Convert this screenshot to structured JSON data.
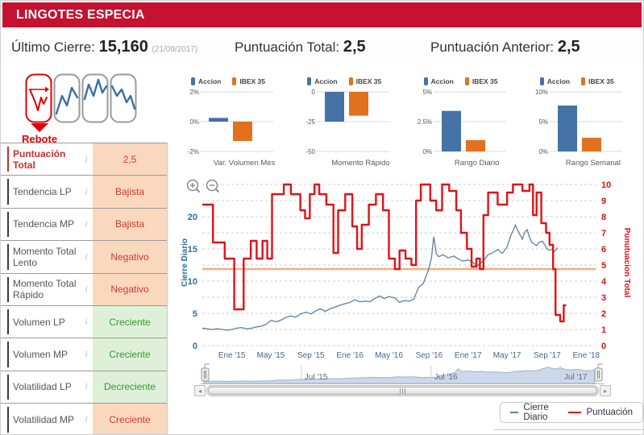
{
  "header": {
    "title": "LINGOTES ESPECIA"
  },
  "summary": {
    "ultimo_cierre": {
      "label": "Último Cierre:",
      "value": "15,160",
      "date": "(21/09/2017)"
    },
    "puntuacion_total": {
      "label": "Puntuación Total:",
      "value": "2,5"
    },
    "puntuacion_anterior": {
      "label": "Puntuación Anterior:",
      "value": "2,5"
    }
  },
  "patterns": {
    "active_label": "Rebote"
  },
  "indicators": {
    "rows": [
      {
        "label": "Puntuación Total",
        "value": "2,5",
        "tone": "neg",
        "highlight": true
      },
      {
        "label": "Tendencia LP",
        "value": "Bajista",
        "tone": "neg"
      },
      {
        "label": "Tendencia MP",
        "value": "Bajista",
        "tone": "neg"
      },
      {
        "label": "Momento Total Lento",
        "value": "Negativo",
        "tone": "neg"
      },
      {
        "label": "Momento Total Rápido",
        "value": "Negativo",
        "tone": "neg"
      },
      {
        "label": "Volumen LP",
        "value": "Creciente",
        "tone": "pos"
      },
      {
        "label": "Volumen MP",
        "value": "Creciente",
        "tone": "pos"
      },
      {
        "label": "Volatilidad LP",
        "value": "Decreciente",
        "tone": "pos"
      },
      {
        "label": "Volatilidad MP",
        "value": "Creciente",
        "tone": "neg"
      }
    ],
    "info_icon": "i"
  },
  "mini_legend": {
    "accion": "Accion",
    "ibex": "IBEX 35"
  },
  "colors": {
    "header_red": "#c51230",
    "accion_blue": "#4572a7",
    "ibex_orange": "#e2711d",
    "line_blue": "#5e7f9e",
    "line_red": "#e01217",
    "plotline_orange": "#f2b07a",
    "neg_bg": "#fad8be",
    "neg_text": "#cc3b33",
    "pos_bg": "#dff0d8",
    "pos_text": "#339933",
    "nav_fill": "#cdd9ea",
    "nav_stroke": "#9ab0cc"
  },
  "chart_data": [
    {
      "id": "var_volumen_mes",
      "type": "bar",
      "title": "Var. Volumen Mes",
      "categories": [
        "Accion",
        "IBEX 35"
      ],
      "values": [
        0.25,
        -1.3
      ],
      "yticks": [
        2,
        0,
        -2
      ],
      "ytick_labels": [
        "2%",
        "0%",
        "-2%"
      ],
      "ylim": [
        -2,
        2
      ]
    },
    {
      "id": "momento_rapido",
      "type": "bar",
      "title": "Momento Rápido",
      "categories": [
        "Accion",
        "IBEX 35"
      ],
      "values": [
        -25,
        -20
      ],
      "yticks": [
        0,
        -25,
        -50
      ],
      "ytick_labels": [
        "0",
        "-25",
        "-50"
      ],
      "ylim": [
        -50,
        0
      ]
    },
    {
      "id": "rango_diario",
      "type": "bar",
      "title": "Rango Diario",
      "categories": [
        "Accion",
        "IBEX 35"
      ],
      "values": [
        3.4,
        0.95
      ],
      "yticks": [
        5,
        2.5,
        0
      ],
      "ytick_labels": [
        "5%",
        "2.5%",
        "0%"
      ],
      "ylim": [
        0,
        5
      ]
    },
    {
      "id": "rango_semanal",
      "type": "bar",
      "title": "Rango Semanal",
      "categories": [
        "Accion",
        "IBEX 35"
      ],
      "values": [
        7.7,
        2.3
      ],
      "yticks": [
        10,
        5,
        0
      ],
      "ytick_labels": [
        "10%",
        "5%",
        "0%"
      ],
      "ylim": [
        0,
        10
      ]
    },
    {
      "id": "main",
      "type": "line",
      "x_range": [
        2014.75,
        2018.08
      ],
      "x_ticks": [
        {
          "t": 2015.0,
          "label": "Ene '15"
        },
        {
          "t": 2015.33,
          "label": "May '15"
        },
        {
          "t": 2015.67,
          "label": "Sep '15"
        },
        {
          "t": 2016.0,
          "label": "Ene '16"
        },
        {
          "t": 2016.33,
          "label": "May '16"
        },
        {
          "t": 2016.67,
          "label": "Sep '16"
        },
        {
          "t": 2017.0,
          "label": "Ene '17"
        },
        {
          "t": 2017.33,
          "label": "May '17"
        },
        {
          "t": 2017.67,
          "label": "Sep '17"
        },
        {
          "t": 2018.0,
          "label": "Ene '18"
        }
      ],
      "left_axis": {
        "label": "Cierre Diario",
        "ticks": [
          0,
          5,
          10,
          15,
          20
        ],
        "range": [
          0,
          25.625
        ]
      },
      "right_axis": {
        "label": "Punutuacion Total",
        "ticks": [
          0,
          1,
          2,
          3,
          4,
          5,
          6,
          7,
          8,
          9,
          10
        ],
        "range": [
          0,
          10.25
        ]
      },
      "plotline": {
        "value": 4.75
      },
      "series": [
        {
          "name": "Cierre Diario",
          "axis": "left",
          "step": false,
          "points": [
            [
              2014.75,
              2.7
            ],
            [
              2014.79,
              2.6
            ],
            [
              2014.83,
              2.5
            ],
            [
              2014.88,
              2.6
            ],
            [
              2014.92,
              2.5
            ],
            [
              2014.96,
              2.4
            ],
            [
              2015.0,
              2.5
            ],
            [
              2015.04,
              2.7
            ],
            [
              2015.08,
              2.8
            ],
            [
              2015.13,
              2.6
            ],
            [
              2015.17,
              2.7
            ],
            [
              2015.21,
              2.9
            ],
            [
              2015.25,
              3.0
            ],
            [
              2015.29,
              3.3
            ],
            [
              2015.33,
              3.9
            ],
            [
              2015.38,
              3.7
            ],
            [
              2015.42,
              4.0
            ],
            [
              2015.46,
              4.4
            ],
            [
              2015.5,
              4.6
            ],
            [
              2015.54,
              4.4
            ],
            [
              2015.58,
              4.9
            ],
            [
              2015.63,
              5.2
            ],
            [
              2015.67,
              4.9
            ],
            [
              2015.71,
              5.4
            ],
            [
              2015.75,
              5.7
            ],
            [
              2015.79,
              5.3
            ],
            [
              2015.83,
              5.7
            ],
            [
              2015.88,
              6.0
            ],
            [
              2015.92,
              6.3
            ],
            [
              2015.96,
              6.5
            ],
            [
              2016.0,
              6.7
            ],
            [
              2016.04,
              7.1
            ],
            [
              2016.08,
              6.8
            ],
            [
              2016.13,
              6.9
            ],
            [
              2016.17,
              6.8
            ],
            [
              2016.21,
              7.3
            ],
            [
              2016.25,
              7.7
            ],
            [
              2016.29,
              7.3
            ],
            [
              2016.33,
              7.6
            ],
            [
              2016.38,
              7.4
            ],
            [
              2016.42,
              6.7
            ],
            [
              2016.46,
              7.0
            ],
            [
              2016.5,
              6.9
            ],
            [
              2016.54,
              7.2
            ],
            [
              2016.58,
              9.0
            ],
            [
              2016.62,
              9.6
            ],
            [
              2016.66,
              11.5
            ],
            [
              2016.69,
              13.6
            ],
            [
              2016.71,
              16.9
            ],
            [
              2016.73,
              14.3
            ],
            [
              2016.75,
              13.8
            ],
            [
              2016.79,
              14.1
            ],
            [
              2016.83,
              13.6
            ],
            [
              2016.88,
              13.9
            ],
            [
              2016.92,
              13.4
            ],
            [
              2016.96,
              13.1
            ],
            [
              2017.0,
              13.3
            ],
            [
              2017.04,
              12.9
            ],
            [
              2017.08,
              12.4
            ],
            [
              2017.13,
              13.2
            ],
            [
              2017.17,
              14.1
            ],
            [
              2017.21,
              14.4
            ],
            [
              2017.25,
              14.9
            ],
            [
              2017.29,
              14.3
            ],
            [
              2017.33,
              15.3
            ],
            [
              2017.36,
              17.0
            ],
            [
              2017.38,
              17.8
            ],
            [
              2017.4,
              18.7
            ],
            [
              2017.42,
              17.9
            ],
            [
              2017.44,
              17.2
            ],
            [
              2017.46,
              16.5
            ],
            [
              2017.48,
              17.6
            ],
            [
              2017.5,
              18.0
            ],
            [
              2017.52,
              16.8
            ],
            [
              2017.54,
              16.0
            ],
            [
              2017.58,
              15.5
            ],
            [
              2017.6,
              16.0
            ],
            [
              2017.63,
              16.2
            ],
            [
              2017.65,
              15.6
            ],
            [
              2017.67,
              15.0
            ],
            [
              2017.69,
              14.8
            ],
            [
              2017.71,
              14.9
            ],
            [
              2017.73,
              14.6
            ],
            [
              2017.76,
              15.2
            ]
          ]
        },
        {
          "name": "Puntuación",
          "axis": "right",
          "step": true,
          "points": [
            [
              2014.75,
              8.75
            ],
            [
              2014.84,
              6.4
            ],
            [
              2014.94,
              5.4
            ],
            [
              2015.02,
              2.25
            ],
            [
              2015.1,
              5.4
            ],
            [
              2015.16,
              6.5
            ],
            [
              2015.21,
              5.4
            ],
            [
              2015.26,
              6.5
            ],
            [
              2015.3,
              5.4
            ],
            [
              2015.34,
              9.4
            ],
            [
              2015.44,
              10
            ],
            [
              2015.5,
              9.4
            ],
            [
              2015.58,
              8.4
            ],
            [
              2015.62,
              7.9
            ],
            [
              2015.66,
              9.4
            ],
            [
              2015.7,
              10
            ],
            [
              2015.74,
              9.4
            ],
            [
              2015.8,
              8.75
            ],
            [
              2015.86,
              5.75
            ],
            [
              2015.9,
              8.4
            ],
            [
              2015.96,
              9.4
            ],
            [
              2016.02,
              7.4
            ],
            [
              2016.06,
              6.0
            ],
            [
              2016.1,
              7.5
            ],
            [
              2016.16,
              8.75
            ],
            [
              2016.22,
              9.4
            ],
            [
              2016.28,
              8.4
            ],
            [
              2016.33,
              5.4
            ],
            [
              2016.38,
              4.75
            ],
            [
              2016.42,
              5.9
            ],
            [
              2016.47,
              5.4
            ],
            [
              2016.52,
              5.0
            ],
            [
              2016.56,
              9.0
            ],
            [
              2016.6,
              10
            ],
            [
              2016.68,
              9.0
            ],
            [
              2016.73,
              8.4
            ],
            [
              2016.78,
              10
            ],
            [
              2016.84,
              9.6
            ],
            [
              2016.9,
              8.4
            ],
            [
              2016.94,
              7.0
            ],
            [
              2016.99,
              6.0
            ],
            [
              2017.03,
              4.9
            ],
            [
              2017.07,
              5.4
            ],
            [
              2017.1,
              4.75
            ],
            [
              2017.13,
              8.1
            ],
            [
              2017.17,
              9.5
            ],
            [
              2017.25,
              8.75
            ],
            [
              2017.33,
              9.5
            ],
            [
              2017.38,
              10
            ],
            [
              2017.46,
              9.6
            ],
            [
              2017.52,
              10
            ],
            [
              2017.55,
              8.1
            ],
            [
              2017.58,
              9.5
            ],
            [
              2017.62,
              7.6
            ],
            [
              2017.66,
              7.0
            ],
            [
              2017.69,
              6.25
            ],
            [
              2017.72,
              4.75
            ],
            [
              2017.74,
              1.9
            ],
            [
              2017.78,
              1.5
            ],
            [
              2017.81,
              2.5
            ],
            [
              2017.83,
              2.5
            ]
          ]
        }
      ]
    },
    {
      "id": "navigator",
      "type": "area",
      "x_range": [
        2014.75,
        2017.78
      ],
      "labels": [
        {
          "t": 2015.5,
          "label": "Jul '15"
        },
        {
          "t": 2016.5,
          "label": "Jul '16"
        },
        {
          "t": 2017.5,
          "label": "Jul '17"
        }
      ]
    }
  ],
  "chart_legend": [
    {
      "name": "Cierre Diario",
      "color": "#5e7f9e"
    },
    {
      "name": "Puntuación",
      "color": "#e01217"
    }
  ],
  "scrollbar": {
    "left_arrow": "◂",
    "right_arrow": "▸"
  }
}
